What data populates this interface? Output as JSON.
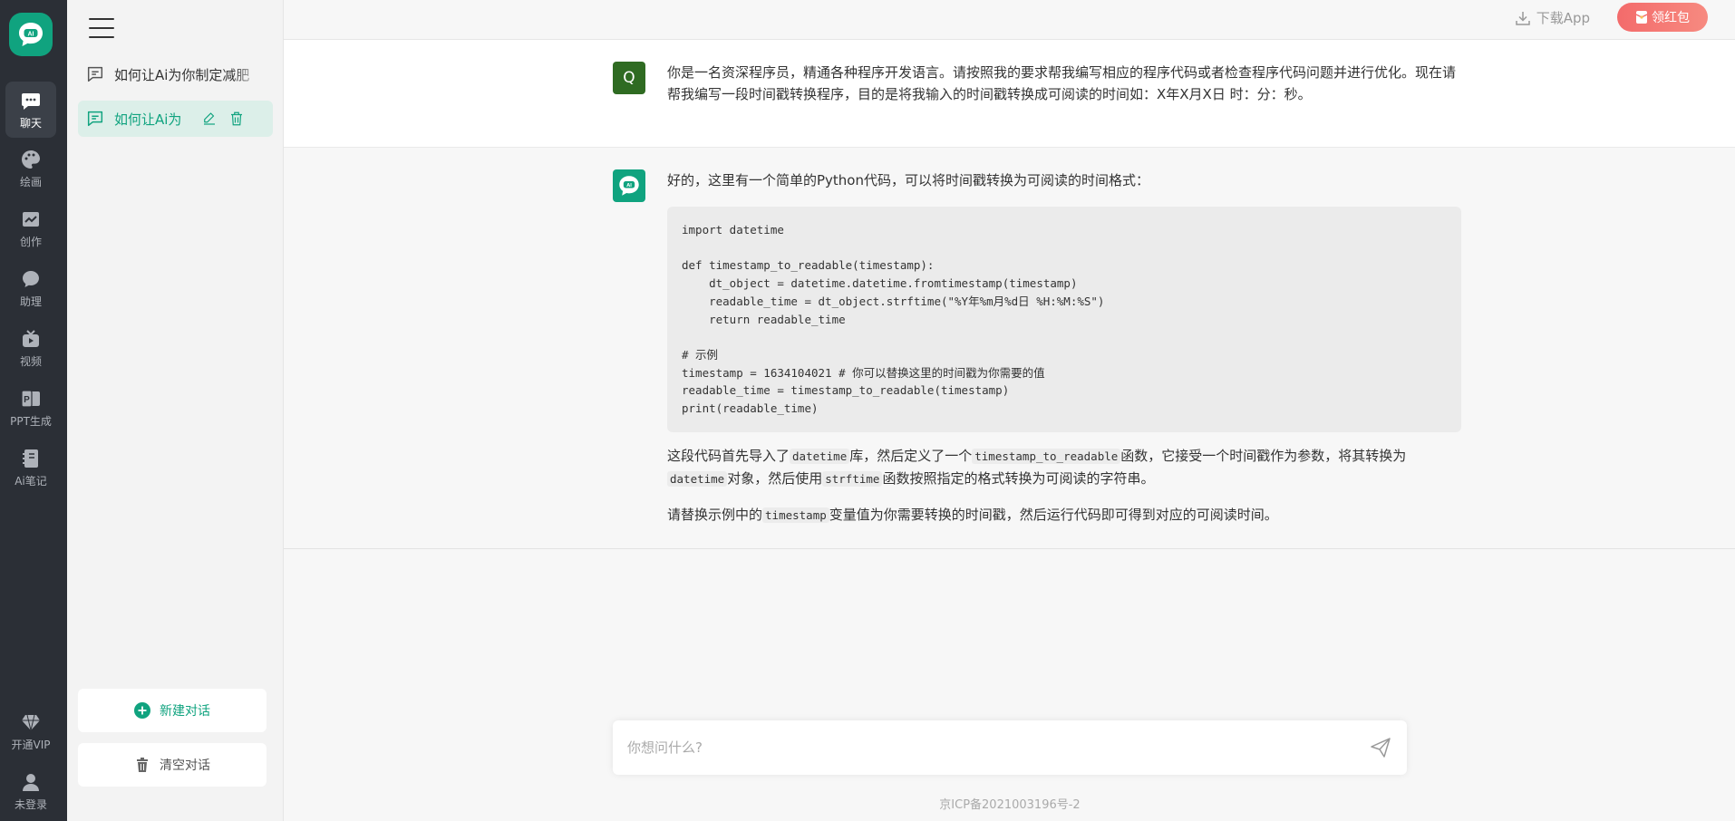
{
  "rail": {
    "items": [
      {
        "label": "聊天",
        "icon": "chat-icon"
      },
      {
        "label": "绘画",
        "icon": "palette-icon"
      },
      {
        "label": "创作",
        "icon": "chart-icon"
      },
      {
        "label": "助理",
        "icon": "assistant-icon"
      },
      {
        "label": "视频",
        "icon": "video-icon"
      },
      {
        "label": "PPT生成",
        "icon": "ppt-icon"
      },
      {
        "label": "Ai笔记",
        "icon": "notebook-icon"
      }
    ],
    "vip_label": "开通VIP",
    "login_label": "未登录"
  },
  "sidebar": {
    "conversations": [
      {
        "title": "如何让Ai为你制定减肥"
      },
      {
        "title": "如何让Ai为"
      }
    ],
    "new_label": "新建对话",
    "clear_label": "清空对话"
  },
  "topbar": {
    "download_label": "下载App",
    "redpack_label": "领红包"
  },
  "chat": {
    "question_avatar": "Q",
    "question": "你是一名资深程序员，精通各种程序开发语言。请按照我的要求帮我编写相应的程序代码或者检查程序代码问题并进行优化。现在请帮我编写一段时间戳转换程序，目的是将我输入的时间戳转换成可阅读的时间如：X年X月X日 时：分：秒。",
    "answer_intro": "好的，这里有一个简单的Python代码，可以将时间戳转换为可阅读的时间格式：",
    "code": "import datetime\n\ndef timestamp_to_readable(timestamp):\n    dt_object = datetime.datetime.fromtimestamp(timestamp)\n    readable_time = dt_object.strftime(\"%Y年%m月%d日 %H:%M:%S\")\n    return readable_time\n\n# 示例\ntimestamp = 1634104021 # 你可以替换这里的时间戳为你需要的值\nreadable_time = timestamp_to_readable(timestamp)\nprint(readable_time)",
    "p1": {
      "a": "这段代码首先导入了",
      "c1": "datetime",
      "b": "库，然后定义了一个",
      "c2": "timestamp_to_readable",
      "c": "函数，它接受一个时间戳作为参数，将其转换为",
      "c3": "datetime",
      "d": "对象，然后使用",
      "c4": "strftime",
      "e": "函数按照指定的格式转换为可阅读的字符串。"
    },
    "p2": {
      "a": "请替换示例中的",
      "c1": "timestamp",
      "b": "变量值为你需要转换的时间戳，然后运行代码即可得到对应的可阅读时间。"
    }
  },
  "input": {
    "placeholder": "你想问什么?"
  },
  "footer": {
    "icp": "京ICP备2021003196号-2"
  },
  "colors": {
    "accent": "#10a37f",
    "rail_bg": "#2b2f36",
    "question_avatar_bg": "#2f6b22",
    "redpack": "#f36b6b"
  }
}
